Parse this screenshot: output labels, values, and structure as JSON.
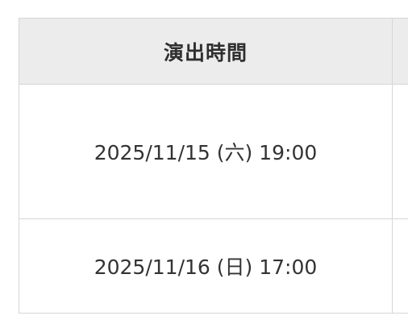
{
  "table": {
    "header": {
      "performance_time": "演出時間"
    },
    "rows": [
      {
        "performance_time": "2025/11/15 (六) 19:00"
      },
      {
        "performance_time": "2025/11/16 (日) 17:00"
      }
    ]
  }
}
